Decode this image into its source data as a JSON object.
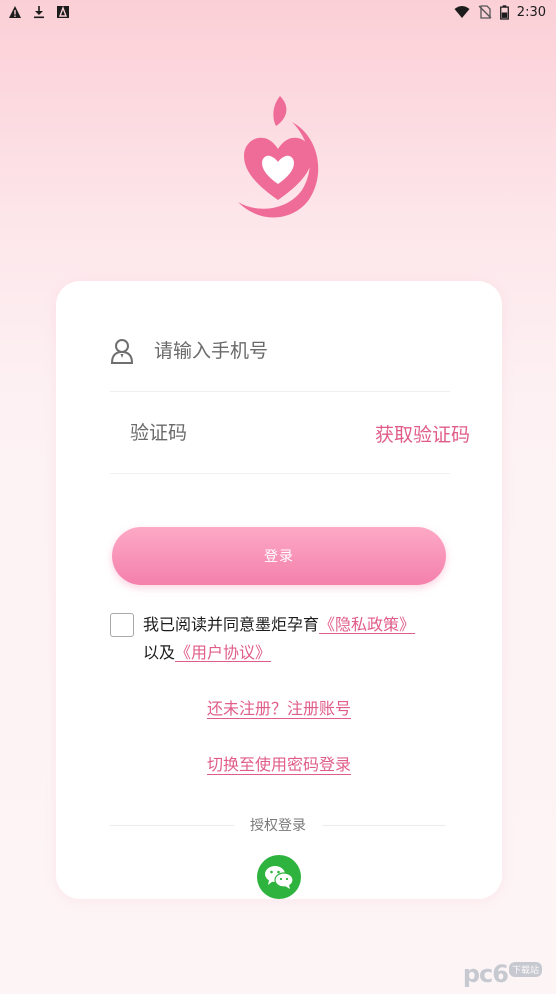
{
  "status_bar": {
    "time": "2:30",
    "left_icons": [
      "warning-icon",
      "download-icon",
      "app-notification-icon"
    ],
    "right_icons": [
      "wifi-icon",
      "no-sim-icon",
      "battery-icon"
    ]
  },
  "logo": {
    "icon": "heart-drop-logo",
    "color": "#ef6c98"
  },
  "form": {
    "phone_placeholder": "请输入手机号",
    "code_placeholder": "验证码",
    "get_code_label": "获取验证码",
    "login_label": "登录"
  },
  "agreement": {
    "prefix": "我已阅读并同意墨炬孕育",
    "privacy_link": "《隐私政策》",
    "middle": "以及",
    "user_link": "《用户协议》",
    "checked": false
  },
  "links": {
    "register": "还未注册？注册账号",
    "switch_password": "切换至使用密码登录"
  },
  "auth": {
    "label": "授权登录",
    "wechat_icon": "wechat-icon"
  },
  "watermark": {
    "text": "pc6",
    "badge": "下载站"
  },
  "colors": {
    "accent": "#e05d8a",
    "button_top": "#fda9c6",
    "button_bottom": "#f480ab",
    "wechat": "#2fb33f"
  }
}
